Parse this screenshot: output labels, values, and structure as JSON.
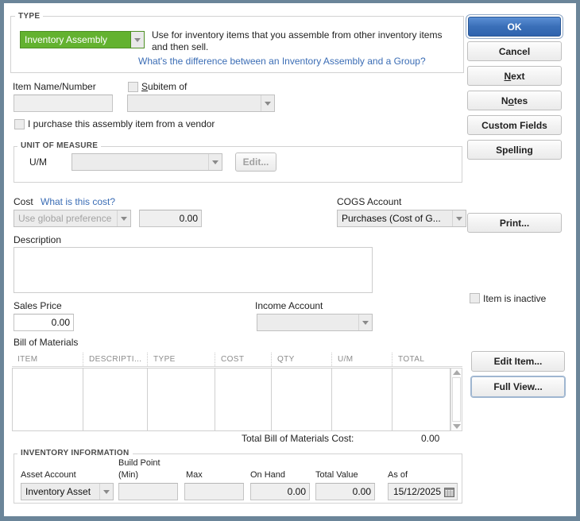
{
  "colors": {
    "accent_green": "#63b22f",
    "primary_blue": "#3a6fb8",
    "link_blue": "#3b6db5",
    "window_border": "#6b8599"
  },
  "type_section": {
    "group_label": "TYPE",
    "selected_type": "Inventory Assembly",
    "help_text": "Use for inventory items that you assemble from other inventory items and then sell.",
    "help_link": "What's the difference between an Inventory Assembly and a Group?"
  },
  "identity": {
    "item_name_label": "Item Name/Number",
    "item_name_value": "",
    "subitem_label": "Subitem of",
    "subitem_checked": false,
    "subitem_value": "",
    "purchase_checkbox_label": "I purchase this assembly item from a vendor",
    "purchase_checked": false
  },
  "unit_of_measure": {
    "group_label": "UNIT OF MEASURE",
    "um_label": "U/M",
    "um_value": "",
    "edit_button": "Edit..."
  },
  "cost_section": {
    "cost_label": "Cost",
    "cost_link": "What is this cost?",
    "cost_mode": "Use global preference",
    "cost_value": "0.00",
    "cogs_label": "COGS Account",
    "cogs_value": "Purchases  (Cost of G..."
  },
  "description": {
    "label": "Description",
    "value": ""
  },
  "sales": {
    "sales_price_label": "Sales Price",
    "sales_price_value": "0.00",
    "income_account_label": "Income Account",
    "income_account_value": ""
  },
  "bom": {
    "label": "Bill of Materials",
    "columns": [
      "ITEM",
      "DESCRIPTI...",
      "TYPE",
      "COST",
      "QTY",
      "U/M",
      "TOTAL"
    ],
    "rows": [],
    "total_label": "Total Bill of Materials Cost:",
    "total_value": "0.00"
  },
  "inventory": {
    "group_label": "INVENTORY INFORMATION",
    "asset_account_label": "Asset Account",
    "asset_account_value": "Inventory Asset",
    "build_point_label_line1": "Build Point",
    "build_point_label_line2": "(Min)",
    "build_point_value": "",
    "max_label": "Max",
    "max_value": "",
    "on_hand_label": "On Hand",
    "on_hand_value": "0.00",
    "total_value_label": "Total Value",
    "total_value_value": "0.00",
    "as_of_label": "As of",
    "as_of_value": "15/12/2025",
    "calendar_icon": "calendar-icon"
  },
  "buttons": {
    "ok": "OK",
    "cancel": "Cancel",
    "next": "Next",
    "notes": "Notes",
    "custom_fields": "Custom Fields",
    "spelling": "Spelling",
    "print": "Print...",
    "edit_item": "Edit Item...",
    "full_view": "Full View..."
  },
  "inactive": {
    "label": "Item is inactive",
    "checked": false
  }
}
